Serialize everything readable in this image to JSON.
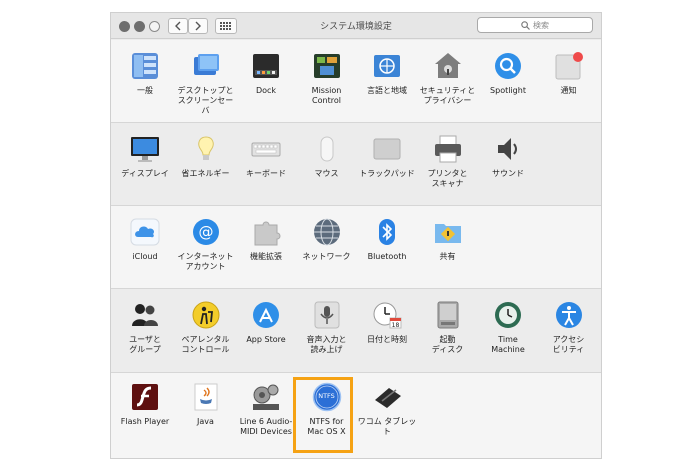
{
  "window": {
    "title": "システム環境設定",
    "search_placeholder": "検索"
  },
  "rows": [
    {
      "items": [
        {
          "label": "一般",
          "icon": "general-icon"
        },
        {
          "label": "デスクトップと\nスクリーンセーバ",
          "icon": "desktop-icon"
        },
        {
          "label": "Dock",
          "icon": "dock-icon"
        },
        {
          "label": "Mission\nControl",
          "icon": "mission-control-icon"
        },
        {
          "label": "言語と地域",
          "icon": "globe-flag-icon"
        },
        {
          "label": "セキュリティと\nプライバシー",
          "icon": "security-house-icon"
        },
        {
          "label": "Spotlight",
          "icon": "spotlight-icon"
        },
        {
          "label": "通知",
          "icon": "notification-icon"
        }
      ]
    },
    {
      "items": [
        {
          "label": "ディスプレイ",
          "icon": "display-icon"
        },
        {
          "label": "省エネルギー",
          "icon": "bulb-icon"
        },
        {
          "label": "キーボード",
          "icon": "keyboard-icon"
        },
        {
          "label": "マウス",
          "icon": "mouse-icon"
        },
        {
          "label": "トラックパッド",
          "icon": "trackpad-icon"
        },
        {
          "label": "プリンタと\nスキャナ",
          "icon": "printer-icon"
        },
        {
          "label": "サウンド",
          "icon": "speaker-icon"
        }
      ]
    },
    {
      "items": [
        {
          "label": "iCloud",
          "icon": "icloud-icon"
        },
        {
          "label": "インターネット\nアカウント",
          "icon": "at-icon"
        },
        {
          "label": "機能拡張",
          "icon": "puzzle-icon"
        },
        {
          "label": "ネットワーク",
          "icon": "network-globe-icon"
        },
        {
          "label": "Bluetooth",
          "icon": "bluetooth-icon"
        },
        {
          "label": "共有",
          "icon": "sharing-folder-icon"
        }
      ]
    },
    {
      "items": [
        {
          "label": "ユーザと\nグループ",
          "icon": "users-icon"
        },
        {
          "label": "ペアレンタル\nコントロール",
          "icon": "parental-icon"
        },
        {
          "label": "App Store",
          "icon": "app-store-icon"
        },
        {
          "label": "音声入力と\n読み上げ",
          "icon": "microphone-icon"
        },
        {
          "label": "日付と時刻",
          "icon": "clock-icon"
        },
        {
          "label": "起動\nディスク",
          "icon": "disk-icon"
        },
        {
          "label": "Time\nMachine",
          "icon": "time-machine-icon"
        },
        {
          "label": "アクセシ\nビリティ",
          "icon": "accessibility-icon"
        }
      ]
    },
    {
      "items": [
        {
          "label": "Flash Player",
          "icon": "flash-icon"
        },
        {
          "label": "Java",
          "icon": "java-icon"
        },
        {
          "label": "Line 6 Audio-\nMIDI Devices",
          "icon": "line6-icon"
        },
        {
          "label": "NTFS for\nMac OS X",
          "icon": "ntfs-icon",
          "badge": "NTFS"
        },
        {
          "label": "ワコム タブレット",
          "icon": "wacom-tablet-icon"
        }
      ]
    }
  ],
  "colors": {
    "highlight": "#f5a214",
    "accent_blue": "#1e88e5"
  }
}
